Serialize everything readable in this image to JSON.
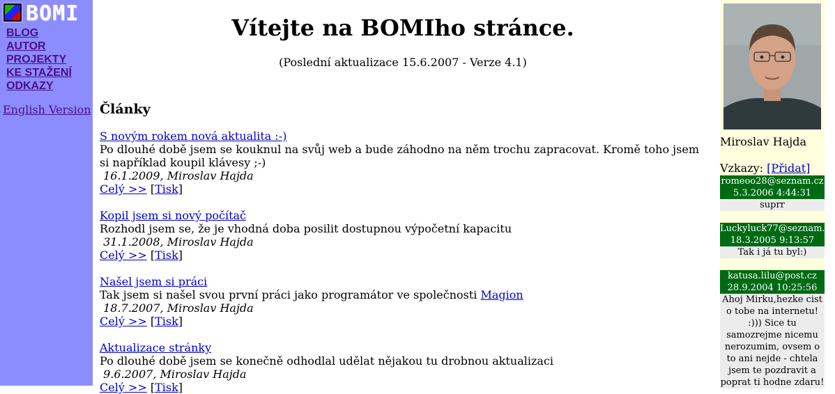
{
  "logo": {
    "text": "BOMI"
  },
  "nav": {
    "items": [
      "BLOG",
      "AUTOR",
      "PROJEKTY",
      "KE STAŽENÍ",
      "ODKAZY"
    ],
    "english": "English Version"
  },
  "header": {
    "title": "Vítejte na BOMIho stránce.",
    "update": "(Poslední aktualizace 15.6.2007 - Verze 4.1)"
  },
  "articles": {
    "heading": "Články",
    "full_label": "Celý >>",
    "print_label": "Tisk",
    "items": [
      {
        "title": "S novým rokem nová aktualita :-)",
        "text": "Po dlouhé době jsem se kouknul na svůj web a bude záhodno na něm trochu zapracovat. Kromě toho jsem si například koupil klávesy ;-)",
        "meta": "16.1.2009, Miroslav Hajda"
      },
      {
        "title": "Kopil jsem si nový počítač",
        "text": "Rozhodl jsem se, že je vhodná doba posilit dostupnou výpočetní kapacitu",
        "meta": "31.1.2008, Miroslav Hajda"
      },
      {
        "title": "Našel jsem si práci",
        "text": "Tak jsem si našel svou první práci jako programátor ve společnosti",
        "link": "Magion",
        "meta": "18.7.2007, Miroslav Hajda"
      },
      {
        "title": "Aktualizace stránky",
        "text": "Po dlouhé době jsem se konečně odhodlal udělat nějakou tu drobnou aktualizaci",
        "meta": "9.6.2007, Miroslav Hajda"
      }
    ]
  },
  "author": {
    "name": "Miroslav Hajda"
  },
  "guestbook": {
    "label": "Vzkazy:",
    "add": "[Přidat]",
    "messages": [
      {
        "email": "romeoo28@seznam.cz",
        "date": "5.3.2006 4:44:31",
        "text": "suprr"
      },
      {
        "email": "Luckyluck77@seznam.",
        "date": "18.3.2005 9:13:57",
        "text": "Tak i já tu byl:)"
      },
      {
        "email": "katusa.lilu@post.cz",
        "date": "28.9.2004 10:25:56",
        "text": "Ahoj Mirku,hezke cist o tobe na internetu! :))) Sice tu samozrejme nicemu nerozumim, ovsem o to ani nejde - chtela jsem te pozdravit a poprat ti hodne zdaru!"
      }
    ]
  },
  "colors": {
    "left_sidebar": "#8c8cff",
    "right_sidebar": "#ffffdd",
    "message_header": "#006a13",
    "nav_link": "#4b0f8a",
    "link": "#0000cc"
  }
}
